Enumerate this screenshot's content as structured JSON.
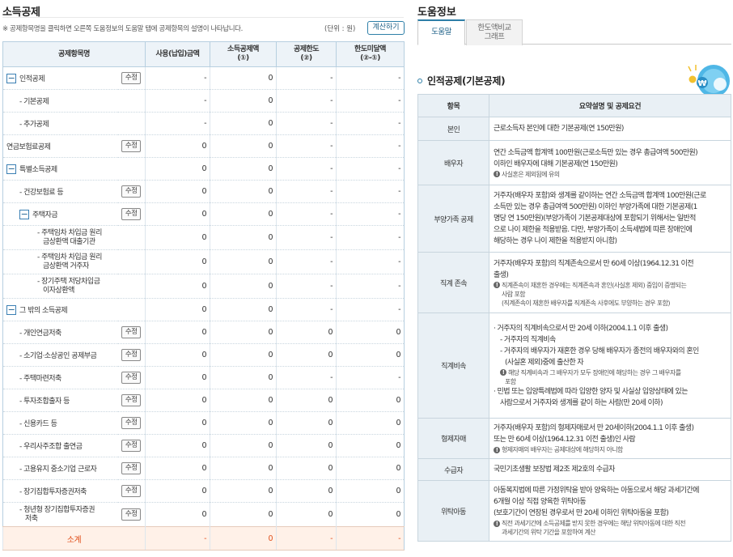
{
  "left": {
    "title": "소득공제",
    "notice": "※ 공제항목명을 클릭하면 오른쪽 도움정보의 도움말 탭에 공제항목의 설명이 나타납니다.",
    "unit": "(단위 : 원)",
    "calc_button": "계산하기",
    "headers": {
      "item": "공제항목명",
      "amount": "사용(납입)금액",
      "deduct_1": "소득공제액",
      "deduct_1b": "(①)",
      "limit_1": "공제한도",
      "limit_1b": "(②)",
      "over_1": "한도미달액",
      "over_1b": "(②-①)"
    },
    "edit_label": "수정",
    "rows": [
      {
        "label": "인적공제",
        "toggle": "−",
        "edit": true,
        "amount": "-",
        "deduct": "0",
        "limit": "-",
        "over": "-"
      },
      {
        "label": "- 기본공제",
        "amount": "-",
        "deduct": "0",
        "limit": "-",
        "over": "-"
      },
      {
        "label": "- 추가공제",
        "amount": "-",
        "deduct": "0",
        "limit": "-",
        "over": "-"
      },
      {
        "label": "연금보험료공제",
        "edit": true,
        "amount": "0",
        "deduct": "0",
        "limit": "-",
        "over": "-"
      },
      {
        "label": "특별소득공제",
        "toggle": "−",
        "amount": "0",
        "deduct": "0",
        "limit": "-",
        "over": "-"
      },
      {
        "label": "- 건강보험료 등",
        "edit": true,
        "amount": "0",
        "deduct": "0",
        "limit": "-",
        "over": "-"
      },
      {
        "label": "주택자금",
        "toggle": "−",
        "edit": true,
        "amount": "0",
        "deduct": "0",
        "limit": "-",
        "over": "-"
      },
      {
        "label": "- 주택임차 차입금 원리",
        "label2": "금상환액 대출기관",
        "amount": "0",
        "deduct": "0",
        "limit": "-",
        "over": "-"
      },
      {
        "label": "- 주택임차 차입금 원리",
        "label2": "금상환액 거주자",
        "amount": "0",
        "deduct": "0",
        "limit": "-",
        "over": "-"
      },
      {
        "label": "- 장기주택 저당차입금",
        "label2": "이자상환액",
        "amount": "0",
        "deduct": "0",
        "limit": "-",
        "over": "-"
      },
      {
        "label": "그 밖의 소득공제",
        "toggle": "−",
        "amount": "0",
        "deduct": "0",
        "limit": "-",
        "over": "-"
      },
      {
        "label": "- 개인연금저축",
        "edit": true,
        "amount": "0",
        "deduct": "0",
        "limit": "0",
        "over": "0"
      },
      {
        "label": "- 소기업·소상공인 공제부금",
        "edit": true,
        "amount": "0",
        "deduct": "0",
        "limit": "0",
        "over": "0"
      },
      {
        "label": "- 주택마련저축",
        "edit": true,
        "amount": "0",
        "deduct": "0",
        "limit": "-",
        "over": "-"
      },
      {
        "label": "- 투자조합출자 등",
        "edit": true,
        "amount": "0",
        "deduct": "0",
        "limit": "0",
        "over": "0"
      },
      {
        "label": "- 신용카드 등",
        "edit": true,
        "amount": "0",
        "deduct": "0",
        "limit": "0",
        "over": "0"
      },
      {
        "label": "- 우리사주조합 출연금",
        "edit": true,
        "amount": "0",
        "deduct": "0",
        "limit": "0",
        "over": "0"
      },
      {
        "label": "- 고용유지 중소기업 근로자",
        "edit": true,
        "amount": "0",
        "deduct": "0",
        "limit": "0",
        "over": "0"
      },
      {
        "label": "- 장기집합투자증권저축",
        "edit": true,
        "amount": "0",
        "deduct": "0",
        "limit": "0",
        "over": "0"
      },
      {
        "label": "- 청년형 장기집합투자증권",
        "label2": "저축",
        "edit": true,
        "amount": "0",
        "deduct": "0",
        "limit": "0",
        "over": "0"
      }
    ],
    "total": {
      "label": "소계",
      "amount": "-",
      "deduct": "0",
      "limit": "-",
      "over": "-"
    }
  },
  "right": {
    "title": "도움정보",
    "tab_help": "도움말",
    "tab_compare_1": "한도액비교",
    "tab_compare_2": "그래프",
    "section_title": "인적공제(기본공제)",
    "col_item": "항목",
    "col_desc": "요약설명 및 공제요건",
    "rows": {
      "self_item": "본인",
      "self_desc": "근로소득자 본인에 대한 기본공제(연 150만원)",
      "spouse_item": "배우자",
      "spouse_desc_1": "연간 소득금액 합계액 100만원(근로소득만 있는 경우 총급여액 500만원)",
      "spouse_desc_2": "이하인 배우자에 대해 기본공제(연 150만원)",
      "spouse_note": "사실혼은 제외됨에 유의",
      "dep_item": "부양가족 공제",
      "dep_desc_1": "거주자(배우자 포함)와 생계를 같이하는 연간 소득금액 합계액 100만원(근로",
      "dep_desc_2": "소득만 있는 경우 총급여액 500만원) 이하인 부양가족에 대한 기본공제(1",
      "dep_desc_3": "명당 연 150만원)(부양가족이 기본공제대상에 포함되기 위해서는 일반적",
      "dep_desc_4": "으로 나이 제한을 적용받음. 다만, 부양가족이 소득세법에 따른 장애인에",
      "dep_desc_5": "해당하는 경우 나이 제한을 적용받지 아니함)",
      "asc_item": "직계 존속",
      "asc_desc_1": "거주자(배우자 포함)의 직계존속으로서 만 60세 이상(1964.12.31 이전",
      "asc_desc_2": "출생)",
      "asc_note_1": "직계존속이 재혼한 경우에는 직계존속과 혼인(사실혼 제외) 중임이 증명되는",
      "asc_note_2": "사람 포함",
      "asc_note_3": "(직계존속이 재혼한 배우자를 직계존속 사후에도 부양하는 경우 포함)",
      "desc_item": "직계비속",
      "desc_desc_1": "거주자의 직계비속으로서 만 20세 이하(2004.1.1 이후 출생)",
      "desc_sub_1": "거주자의 직계비속",
      "desc_sub_2a": "거주자의 배우자가 재혼한 경우 당해 배우자가 종전의 배우자와의 혼인",
      "desc_sub_2b": "(사실혼 제외)중에 출산한 자",
      "desc_note_1": "해당 직계비속과 그 배우자가 모두 장애인에 해당하는 경우 그 배우자를",
      "desc_note_2": "포함",
      "desc_desc_2a": "민법 또는 입양특례법에 따라 입양한 양자 및 사실상 입양상태에 있는",
      "desc_desc_2b": "사람으로서 거주자와 생계를 같이 하는 사람(만 20세 이하)",
      "sib_item": "형제자매",
      "sib_desc_1": "거주자(배우자 포함)의 형제자매로서 만 20세이하(2004.1.1 이후 출생)",
      "sib_desc_2": "또는 만 60세 이상(1964.12.31 이전 출생)인 사람",
      "sib_note": "형제자매의 배우자는 공제대상에 해당하지 아니함",
      "ben_item": "수급자",
      "ben_desc": "국민기초생활 보장법 제2조 제2호의 수급자",
      "foster_item": "위탁아동",
      "foster_desc_1": "아동복지법에 따른 가정위탁을 받아 양육하는 아동으로서 해당 과세기간에",
      "foster_desc_2": "6개월 이상 직접 양육한 위탁아동",
      "foster_desc_3": "(보호기간이 연장된 경우로서 만 20세 이하인 위탁아동을 포함)",
      "foster_note_1": "직전 과세기간에 소득공제를 받지 못한 경우에는 해당 위탁아동에 대한 직전",
      "foster_note_2": "과세기간의 위탁 기간을 포함하여 계산"
    }
  },
  "icons": {
    "toggle": "minus-toggle-icon",
    "note": "exclamation-icon",
    "mascot": "won-coin-mascot-icon"
  },
  "colors": {
    "accent": "#2d7ea7",
    "total_text": "#e0501c",
    "header_bg": "#edf3f8"
  }
}
